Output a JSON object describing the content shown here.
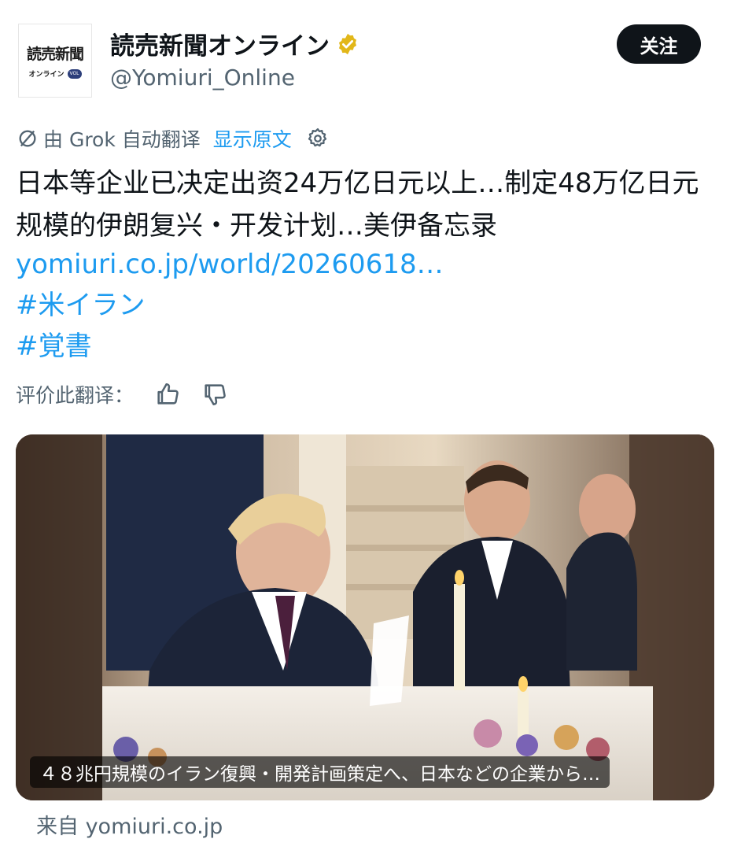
{
  "account": {
    "display_name": "読売新聞オンライン",
    "handle": "@Yomiuri_Online",
    "avatar_logo_text": "読売新聞",
    "avatar_logo_sub": "オンライン",
    "avatar_logo_badge": "VOL",
    "verified_color": "#e2b719"
  },
  "follow_button": {
    "label": "关注"
  },
  "translation": {
    "label": "由 Grok 自动翻译",
    "show_original": "显示原文"
  },
  "tweet": {
    "text": "日本等企业已决定出资24万亿日元以上…制定48万亿日元规模的伊朗复兴・开发计划…美伊备忘录",
    "link": "yomiuri.co.jp/world/20260618…",
    "hashtags": [
      "#米イラン",
      "#覚書"
    ]
  },
  "rate_translation": {
    "label": "评价此翻译："
  },
  "media": {
    "caption": "４８兆円規模のイラン復興・開発計画策定へ、日本などの企業から…"
  },
  "source": {
    "label": "来自 yomiuri.co.jp"
  },
  "colors": {
    "link": "#1d9bf0",
    "text": "#0f1419",
    "secondary": "#536471"
  }
}
